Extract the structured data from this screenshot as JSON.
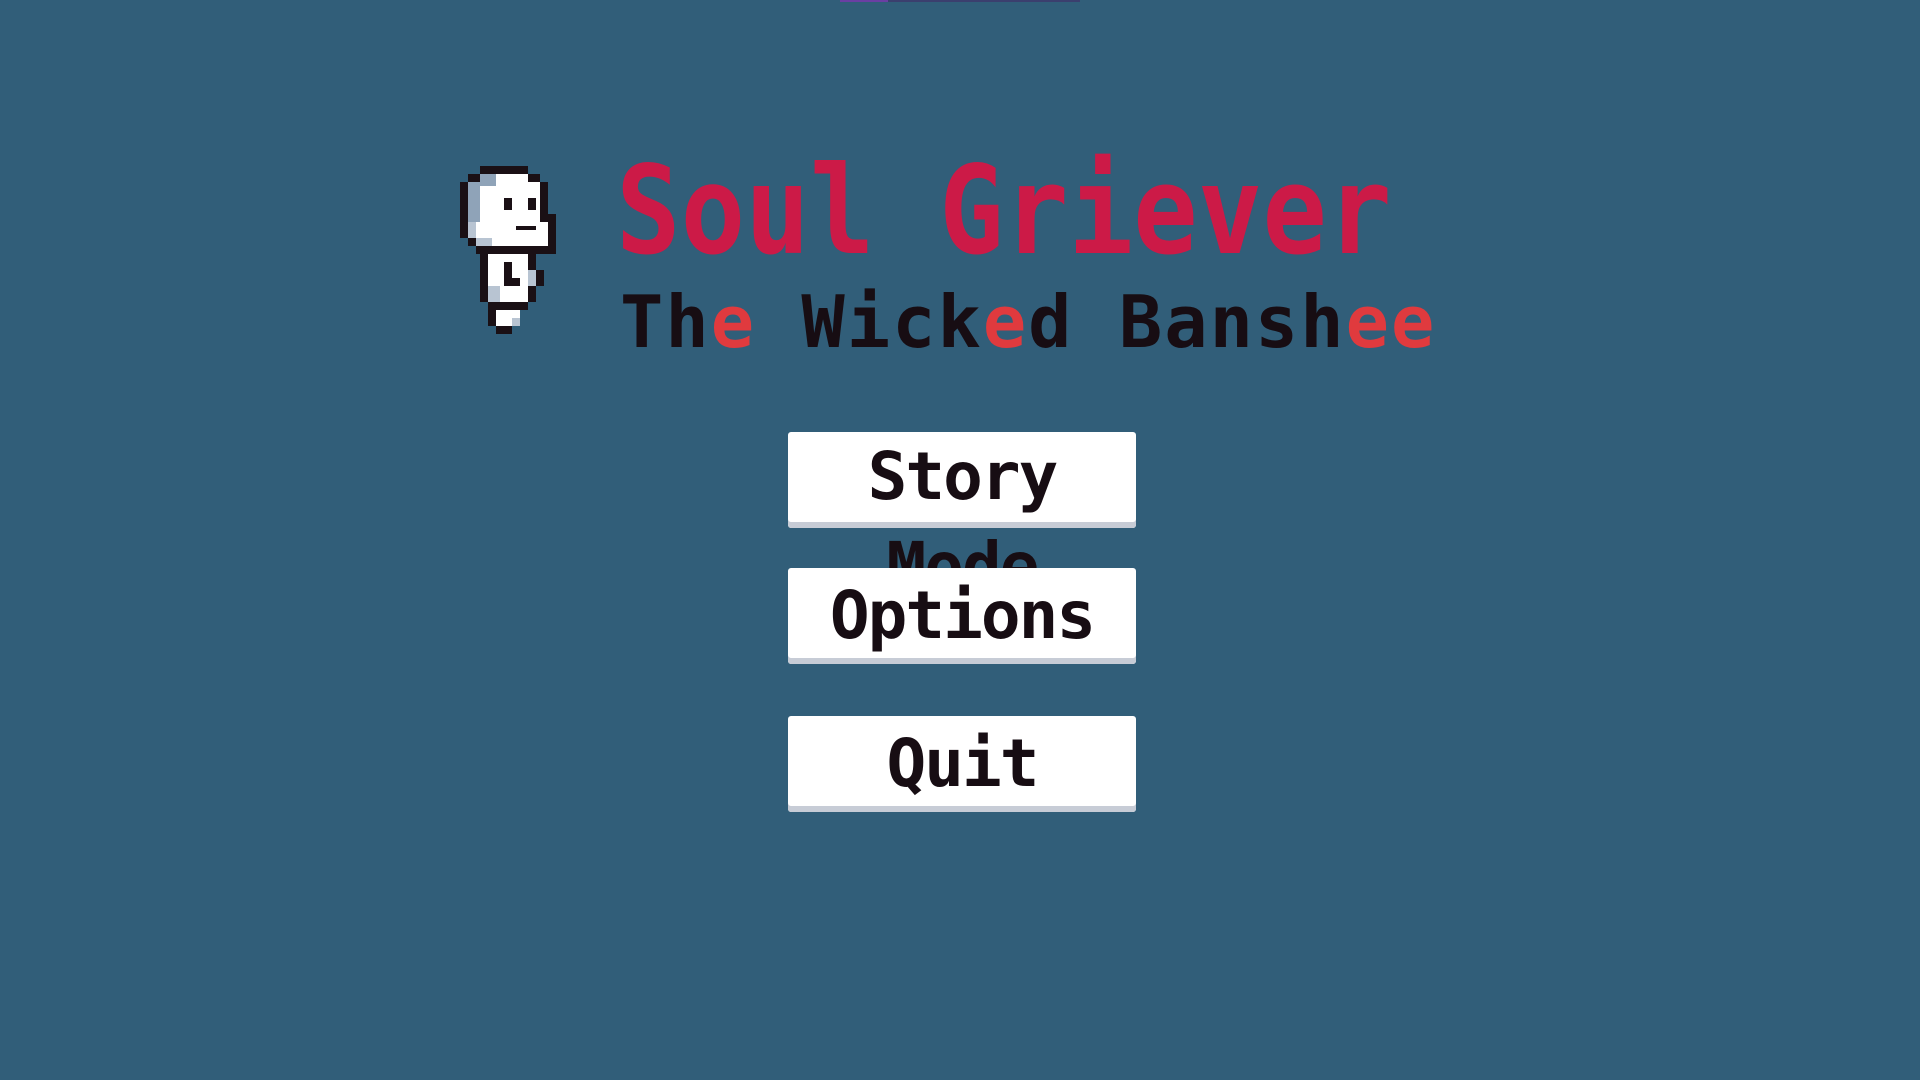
{
  "title": {
    "main": "Soul Griever",
    "subtitle_parts": [
      "Th",
      "e",
      " Wick",
      "e",
      "d Bansh",
      "ee"
    ]
  },
  "mascot": {
    "icon": "ghost-sprite-icon"
  },
  "menu": {
    "story_mode": "Story Mode",
    "options": "Options",
    "quit": "Quit"
  },
  "colors": {
    "background": "#315e79",
    "title": "#cc1a47",
    "subtitle_dark": "#170d13",
    "subtitle_highlight": "#e03a3e",
    "button_bg": "#ffffff"
  }
}
